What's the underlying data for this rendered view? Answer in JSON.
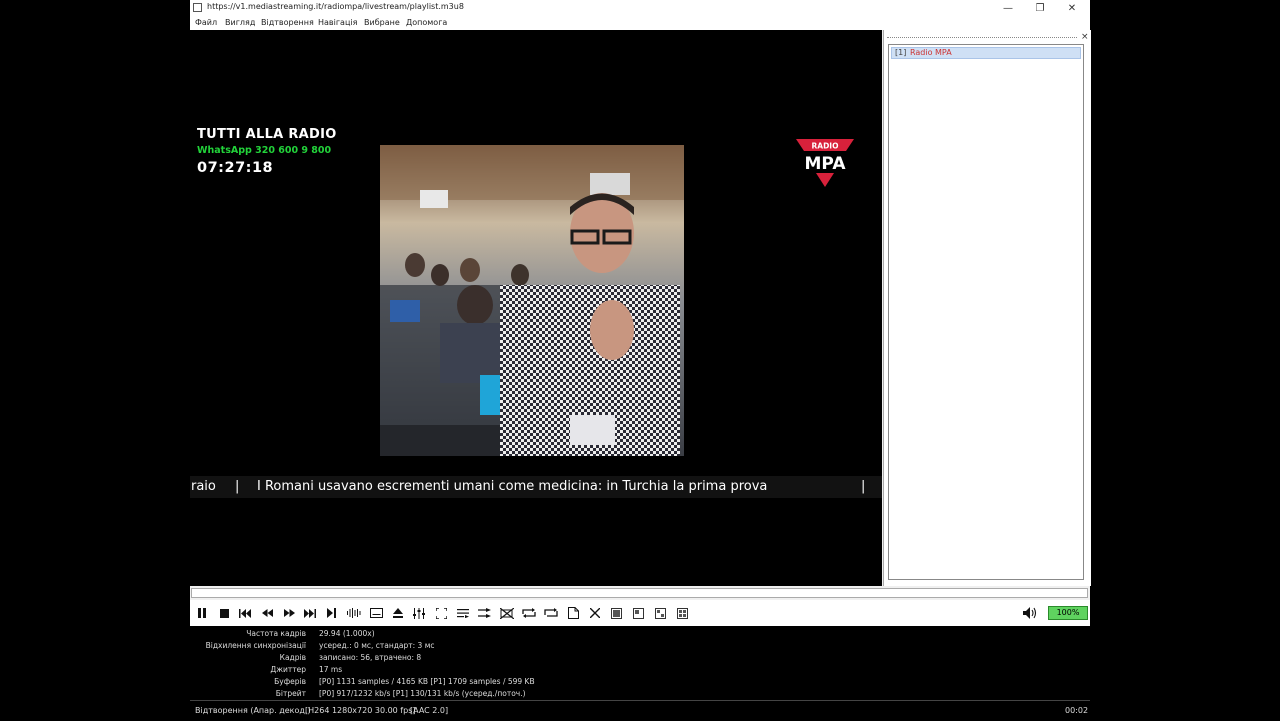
{
  "window": {
    "title": "https://v1.mediastreaming.it/radiompa/livestream/playlist.m3u8",
    "minimize": "—",
    "maximize": "❐",
    "close": "✕"
  },
  "menu": [
    "Файл",
    "Вигляд",
    "Відтворення",
    "Навігація",
    "Вибране",
    "Допомога"
  ],
  "video": {
    "overlay_title": "TUTTI ALLA RADIO",
    "overlay_whatsapp": "WhatsApp 320 600 9 800",
    "overlay_clock": "07:27:18",
    "logo_top": "RADIO",
    "logo_main": "MPA",
    "ticker_left": "raio",
    "ticker_sep": "|",
    "ticker_text": "I Romani usavano escrementi umani come medicina: in Turchia la prima prova"
  },
  "playlist": {
    "close": "×",
    "items": [
      {
        "index": "[1]",
        "name": "Radio MPA"
      }
    ]
  },
  "controls": {
    "volume_percent": "100%"
  },
  "stats": [
    {
      "label": "Частота кадрів",
      "value": "29.94 (1.000x)"
    },
    {
      "label": "Відхилення синхронізації",
      "value": "усеред.: 0 мс, стандарт: 3 мс"
    },
    {
      "label": "Кадрів",
      "value": "записано: 56, втрачено: 8"
    },
    {
      "label": "Джиттер",
      "value": "17 ms"
    },
    {
      "label": "Буферів",
      "value": "[P0] 1131 samples / 4165 KB   [P1] 1709 samples / 599 KB"
    },
    {
      "label": "Бітрейт",
      "value": "[P0] 917/1232 kb/s   [P1] 130/131 kb/s   (усеред./поточ.)"
    }
  ],
  "status": {
    "state": "Відтворення (Апар. декод.)",
    "video_codec": "[H264 1280x720 30.00 fps]",
    "audio_codec": "[AAC 2.0]",
    "time": "00:02"
  },
  "colors": {
    "accent_green": "#22d33a",
    "volume_fill": "#5fd35f",
    "selection": "#cfe0f5",
    "logo_red": "#d8213b"
  }
}
